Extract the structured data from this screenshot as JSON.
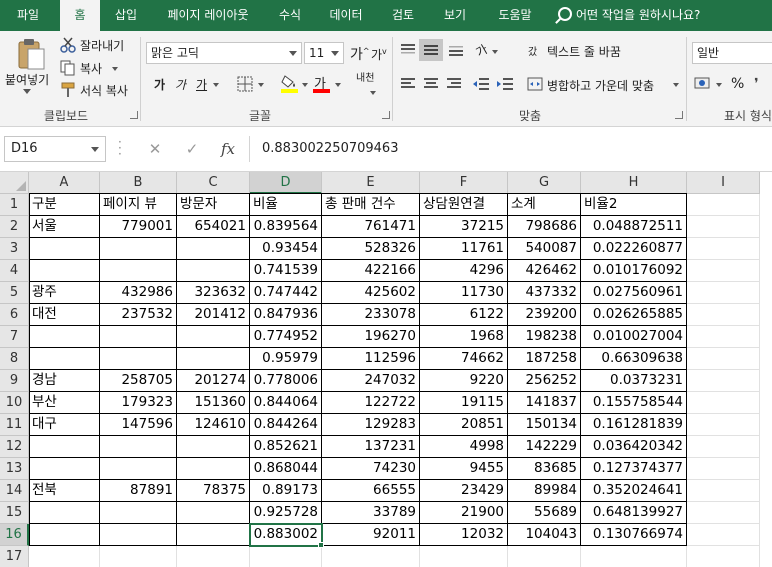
{
  "ribbon_tabs": [
    "파일",
    "홈",
    "삽입",
    "페이지 레이아웃",
    "수식",
    "데이터",
    "검토",
    "보기",
    "도움말"
  ],
  "active_tab": "홈",
  "tell_me": "어떤 작업을 원하시나요?",
  "clipboard": {
    "paste": "붙여넣기",
    "cut": "잘라내기",
    "copy": "복사",
    "format_painter": "서식 복사",
    "label": "클립보드"
  },
  "font": {
    "name": "맑은 고딕",
    "size": "11",
    "label": "글꼴",
    "grow": "가",
    "shrink": "가",
    "bold": "가",
    "italic": "가",
    "underline": "가",
    "font_color_glyph": "가",
    "phonetic": "내천"
  },
  "alignment": {
    "wrap_text": "텍스트 줄 바꿈",
    "merge_center": "병합하고 가운데 맞춤",
    "label": "맞춤",
    "orientation_glyph": "가",
    "wrap_glyph": "갔"
  },
  "number": {
    "format": "일반",
    "label": "표시 형식",
    "percent": "%"
  },
  "colors": {
    "excel_green": "#217346",
    "fill_yellow": "#ffff00",
    "font_red": "#ff0000"
  },
  "formula_bar": {
    "name_box": "D16",
    "value": "0.883002250709463",
    "cancel": "✕",
    "enter": "✓",
    "fx": "fx"
  },
  "sheet": {
    "columns": [
      "A",
      "B",
      "C",
      "D",
      "E",
      "F",
      "G",
      "H",
      "I"
    ],
    "selected_column": "D",
    "selected_row": "16",
    "row_numbers": [
      "1",
      "2",
      "3",
      "4",
      "5",
      "6",
      "7",
      "8",
      "9",
      "10",
      "11",
      "12",
      "13",
      "14",
      "15",
      "16",
      "17"
    ],
    "rows": [
      [
        "구분",
        "페이지 뷰",
        "방문자",
        "비율",
        "총 판매 건수",
        "상담원연결",
        "소계",
        "비율2"
      ],
      [
        "서울",
        "779001",
        "654021",
        "0.839564",
        "761471",
        "37215",
        "798686",
        "0.048872511"
      ],
      [
        "",
        "",
        "",
        "0.93454",
        "528326",
        "11761",
        "540087",
        "0.022260877"
      ],
      [
        "",
        "",
        "",
        "0.741539",
        "422166",
        "4296",
        "426462",
        "0.010176092"
      ],
      [
        "광주",
        "432986",
        "323632",
        "0.747442",
        "425602",
        "11730",
        "437332",
        "0.027560961"
      ],
      [
        "대전",
        "237532",
        "201412",
        "0.847936",
        "233078",
        "6122",
        "239200",
        "0.026265885"
      ],
      [
        "",
        "",
        "",
        "0.774952",
        "196270",
        "1968",
        "198238",
        "0.010027004"
      ],
      [
        "",
        "",
        "",
        "0.95979",
        "112596",
        "74662",
        "187258",
        "0.66309638"
      ],
      [
        "경남",
        "258705",
        "201274",
        "0.778006",
        "247032",
        "9220",
        "256252",
        "0.0373231"
      ],
      [
        "부산",
        "179323",
        "151360",
        "0.844064",
        "122722",
        "19115",
        "141837",
        "0.155758544"
      ],
      [
        "대구",
        "147596",
        "124610",
        "0.844264",
        "129283",
        "20851",
        "150134",
        "0.161281839"
      ],
      [
        "",
        "",
        "",
        "0.852621",
        "137231",
        "4998",
        "142229",
        "0.036420342"
      ],
      [
        "",
        "",
        "",
        "0.868044",
        "74230",
        "9455",
        "83685",
        "0.127374377"
      ],
      [
        "전북",
        "87891",
        "78375",
        "0.89173",
        "66555",
        "23429",
        "89984",
        "0.352024641"
      ],
      [
        "",
        "",
        "",
        "0.925728",
        "33789",
        "21900",
        "55689",
        "0.648139927"
      ],
      [
        "",
        "",
        "",
        "0.883002",
        "92011",
        "12032",
        "104043",
        "0.130766974"
      ],
      [
        "",
        "",
        "",
        "",
        "",
        "",
        "",
        ""
      ]
    ]
  }
}
